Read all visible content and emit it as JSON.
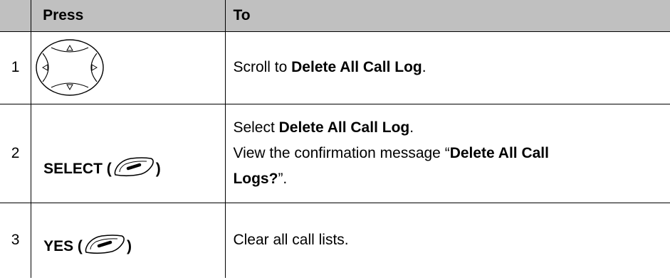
{
  "table": {
    "header": {
      "step": "",
      "press": "Press",
      "to": "To"
    },
    "rows": [
      {
        "step": "1",
        "press_icon": "navigation-key-icon",
        "to": {
          "prefix": "Scroll to ",
          "bold": "Delete All Call Log",
          "suffix": "."
        }
      },
      {
        "step": "2",
        "press_label": "SELECT (",
        "press_icon": "soft-key-icon",
        "press_close": ")",
        "to_line1": {
          "prefix": "Select ",
          "bold": "Delete All Call Log",
          "suffix": "."
        },
        "to_line2": {
          "prefix": "View the confirmation message “",
          "bold": "Delete All Call",
          "suffix": ""
        },
        "to_line3": {
          "prefix": "",
          "bold": "Logs?",
          "suffix": "”."
        }
      },
      {
        "step": "3",
        "press_label": "YES (",
        "press_icon": "soft-key-icon",
        "press_close": ")",
        "to": "Clear all call lists."
      }
    ]
  },
  "colors": {
    "header_bg": "#c0c0c0",
    "border": "#000000"
  }
}
